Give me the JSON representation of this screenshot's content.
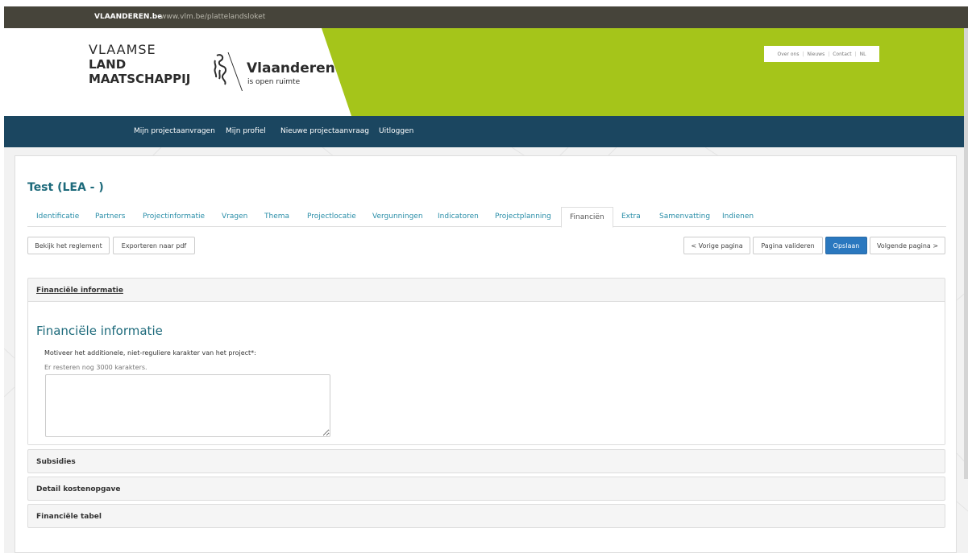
{
  "topbar": {
    "brand": "VLAANDEREN.be",
    "url": "www.vlm.be/plattelandsloket"
  },
  "logo": {
    "line1": "VLAAMSE",
    "line2": "LAND",
    "line3": "MAATSCHAPPIJ"
  },
  "vlaanderen_logo": {
    "name": "Vlaanderen",
    "tagline": "is open ruimte",
    "icon": "lion-icon"
  },
  "utility_nav": [
    "Over ons",
    "Nieuws",
    "Contact",
    "NL"
  ],
  "main_nav": [
    "Mijn projectaanvragen",
    "Mijn profiel",
    "Nieuwe projectaanvraag",
    "Uitloggen"
  ],
  "page": {
    "title": "Test (LEA - )"
  },
  "tabs": [
    "Identificatie",
    "Partners",
    "Projectinformatie",
    "Vragen",
    "Thema",
    "Projectlocatie",
    "Vergunningen",
    "Indicatoren",
    "Projectplanning",
    "Financiën",
    "Extra",
    "Samenvatting",
    "Indienen"
  ],
  "active_tab": "Financiën",
  "toolbar": {
    "regulation": "Bekijk het reglement",
    "export_pdf": "Exporteren naar pdf",
    "prev": "< Vorige pagina",
    "validate": "Pagina valideren",
    "save": "Opslaan",
    "next": "Volgende pagina >"
  },
  "panels": {
    "financial_info": {
      "heading": "Financiële informatie",
      "section_title": "Financiële informatie",
      "question": "Motiveer het additionele, niet-reguliere karakter van het project*:",
      "hint": "Er resteren nog 3000 karakters.",
      "answer": ""
    },
    "subsidies": "Subsidies",
    "cost_detail": "Detail kostenopgave",
    "financial_table": "Financiële tabel"
  },
  "colors": {
    "topbar": "#46443a",
    "header_green": "#a5c51a",
    "nav": "#1b4660",
    "title": "#1d6a7b",
    "link": "#2a8ea8",
    "primary": "#2a78bf"
  }
}
